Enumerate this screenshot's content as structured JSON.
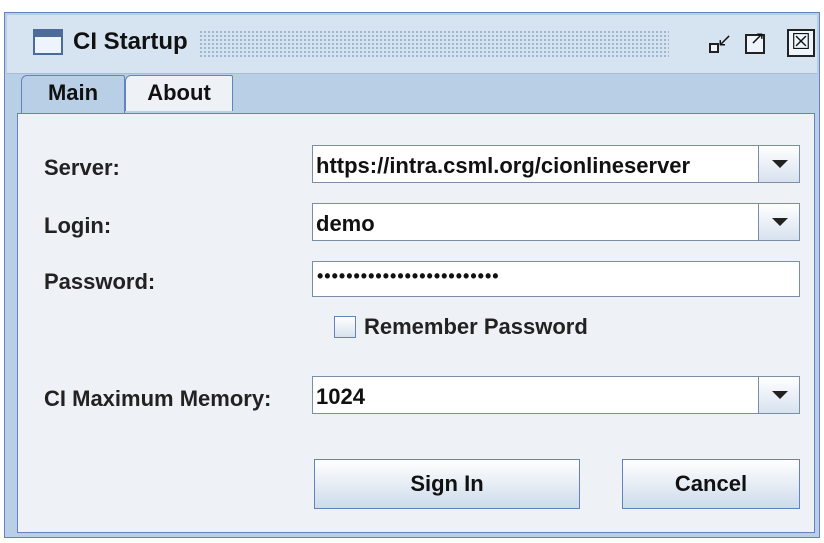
{
  "window": {
    "title": "CI Startup",
    "icons": [
      "window-icon",
      "minimize-icon",
      "maximize-icon",
      "close-icon"
    ],
    "close_glyph": "☒"
  },
  "tabs": [
    {
      "label": "Main",
      "selected": true
    },
    {
      "label": "About",
      "selected": false
    }
  ],
  "form": {
    "server": {
      "label": "Server:",
      "value": "https://intra.csml.org/cionlineserver"
    },
    "login": {
      "label": "Login:",
      "value": "demo"
    },
    "password": {
      "label": "Password:",
      "value": "•••••••••••••••••••••••••"
    },
    "remember": {
      "label": "Remember Password",
      "checked": false
    },
    "memory": {
      "label": "CI Maximum Memory:",
      "value": "1024"
    }
  },
  "actions": {
    "sign_in": "Sign In",
    "cancel": "Cancel"
  },
  "colors": {
    "accent": "#6382bf",
    "panel": "#eef2f7",
    "titlebar": "#d6e4f2"
  }
}
